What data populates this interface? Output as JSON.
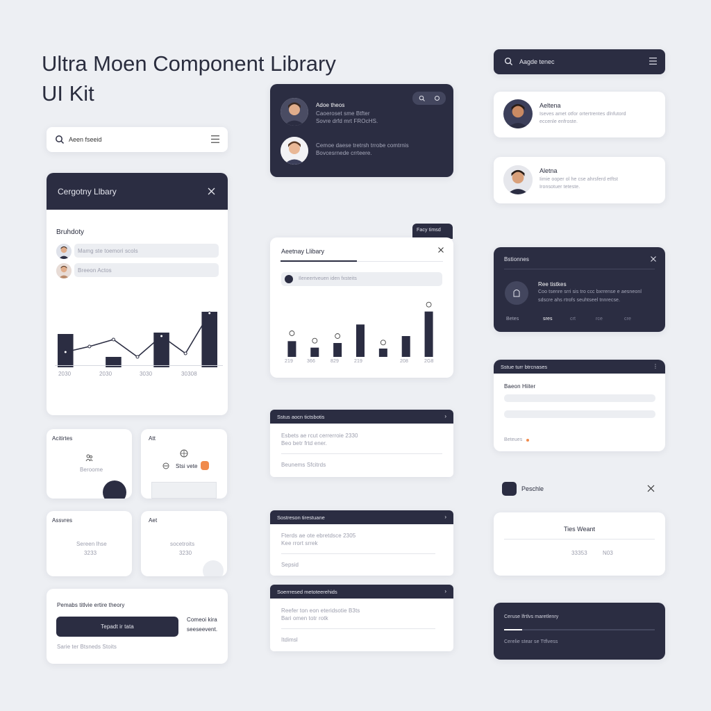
{
  "title": {
    "line1": "Ultra Moen Component Library",
    "line2": "UI Kit"
  },
  "search_left": {
    "value": "Aeen fseeid"
  },
  "search_right": {
    "value": "Aagde tenec"
  },
  "category_modal": {
    "title": "Cergotny Llbary",
    "section": "Bruhdoty",
    "row1": "Mamg ste toemori scols",
    "row2": "Breeon Actos",
    "chart_labels": [
      "2030",
      "2030",
      "3030",
      "30308"
    ]
  },
  "chat_card": {
    "name": "Adoe theos",
    "line1": "Caoeroset sme Btfter",
    "line2": "Sovre drfd mrt FROcHS.",
    "line3": "Cemoe daese tretrsh trrobe comtrnis",
    "line4": "Bovcesrnede crrteere."
  },
  "profile1": {
    "name": "Aeltena",
    "line1": "Iseves amet otfor ortertrentes dlnfutord",
    "line2": "eccenle enfroste."
  },
  "profile2": {
    "name": "Aletna",
    "line1": "Iimie ooper ol he cse ahrsferd etftst",
    "line2": "Ironsotuer teteste."
  },
  "library_modal": {
    "tag": "Facy timsd",
    "title": "Aeetnay Llibary",
    "search": "Ileneertveuen iden fxsteits",
    "x_labels": [
      "219",
      "366",
      "829",
      "219",
      "",
      "208",
      "2G8"
    ]
  },
  "settings_card": {
    "title": "Bstionnes",
    "name": "Ree tistkes",
    "line1": "Coo tsenre srri sis tro ccc bxrrense e aesneonl",
    "line2": "sdscre ahs rtrofs seuhtseel tnnrecse.",
    "tabs": [
      "Betes",
      "sres",
      "crt",
      "rce",
      "cre"
    ]
  },
  "tile1": {
    "title": "Acitirtes",
    "label": "Beroome"
  },
  "tile2": {
    "title": "Att",
    "label": "Stsi vete"
  },
  "tile3": {
    "title": "Assvres",
    "line1": "Sereen lhse",
    "line2": "3233"
  },
  "tile4": {
    "title": "Aet",
    "line1": "socetroits",
    "line2": "3230"
  },
  "acc1": {
    "header": "Sstus aocn tictsbotis",
    "line1": "Esbets ae rcut cerrerroie  2330",
    "line2": "Beo betr frtd ener.",
    "footer": "Beunems  Sfcitrds"
  },
  "acc2": {
    "header": "Sostreson tirestuane",
    "line1": "Fterds ae ote ebretdsce  2305",
    "line2": "Kee rrort srrek",
    "footer": "Sepsid"
  },
  "acc3": {
    "header": "Soerrresed metoteerehids",
    "line1": "Reefer ton eon eteridsotie  B3ts",
    "line2": "Bari omen totr rotk",
    "footer": "Itdimsl"
  },
  "form_card": {
    "header": "Sstue turr btrcnases",
    "label": "Baeon Hiiter",
    "footer": "Beteues"
  },
  "button_card": {
    "title": "Pemabs titlvie ertire theory",
    "button": "Tepadt ir tata",
    "side1": "Comeoi kira",
    "side2": "seeseevent.",
    "footer": "Sarie ter  Btsneds  Stoits"
  },
  "checkbox_row": {
    "label": "Peschle"
  },
  "dialog_card": {
    "title": "Ties Weant",
    "v1": "33353",
    "v2": "N03"
  },
  "progress_card": {
    "title": "Ceruse lfrtlvs maretlenry",
    "footer": "Cerelie  stear  se  Ttflvess",
    "progress": 0.12
  },
  "colors": {
    "dark": "#2b2d42",
    "accent": "#f08a4b",
    "bg": "#edeff3"
  },
  "chart_data": [
    {
      "type": "bar",
      "categories": [
        "1",
        "2",
        "3",
        "4",
        "5",
        "6",
        "7"
      ],
      "series": [
        {
          "values": [
            48,
            0,
            15,
            0,
            50,
            0,
            80
          ]
        },
        {
          "values": [
            22,
            30,
            40,
            15,
            45,
            20,
            78
          ]
        }
      ],
      "x_tick_labels": [
        "2030",
        "2030",
        "3030",
        "30308"
      ],
      "ylim": [
        0,
        100
      ]
    },
    {
      "type": "bar",
      "categories": [
        "219",
        "366",
        "829",
        "219",
        "",
        "208",
        "2G8"
      ],
      "values": [
        34,
        20,
        30,
        70,
        18,
        45,
        98
      ],
      "marker_values": [
        48,
        32,
        42,
        0,
        28,
        0,
        110
      ],
      "ylim": [
        0,
        120
      ]
    }
  ]
}
